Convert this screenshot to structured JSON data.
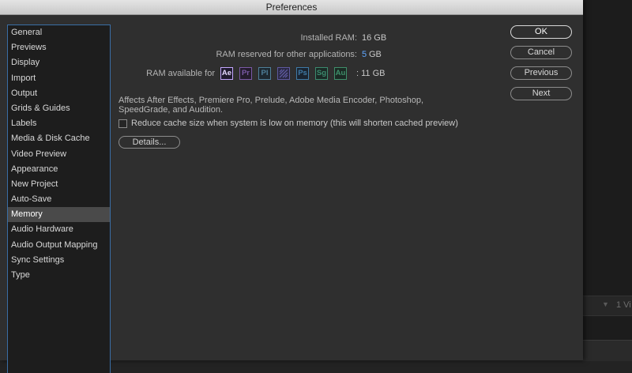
{
  "window": {
    "title": "Preferences"
  },
  "sidebar": {
    "items": [
      {
        "label": "General"
      },
      {
        "label": "Previews"
      },
      {
        "label": "Display"
      },
      {
        "label": "Import"
      },
      {
        "label": "Output"
      },
      {
        "label": "Grids & Guides"
      },
      {
        "label": "Labels"
      },
      {
        "label": "Media & Disk Cache"
      },
      {
        "label": "Video Preview"
      },
      {
        "label": "Appearance"
      },
      {
        "label": "New Project"
      },
      {
        "label": "Auto-Save"
      },
      {
        "label": "Memory",
        "selected": true
      },
      {
        "label": "Audio Hardware"
      },
      {
        "label": "Audio Output Mapping"
      },
      {
        "label": "Sync Settings"
      },
      {
        "label": "Type"
      }
    ]
  },
  "memory": {
    "installed_label": "Installed RAM:",
    "installed_value": "16 GB",
    "reserved_label": "RAM reserved for other applications:",
    "reserved_value": "5",
    "reserved_unit": "GB",
    "available_label": "RAM available for",
    "available_value": ": 11 GB",
    "apps": [
      {
        "abbr": "Ae",
        "color": "#c3a6ff",
        "bg": "#1f1a2e",
        "icon": "after-effects-icon"
      },
      {
        "abbr": "Pr",
        "color": "#7b5aa6",
        "bg": "#241c2c",
        "icon": "premiere-pro-icon"
      },
      {
        "abbr": "Pl",
        "color": "#4f7f9a",
        "bg": "#1d2830",
        "icon": "prelude-icon"
      },
      {
        "abbr": "",
        "color": "#5e5aa0",
        "bg": "#2a2842",
        "icon": "media-encoder-icon"
      },
      {
        "abbr": "Ps",
        "color": "#3f7aa6",
        "bg": "#1a2430",
        "icon": "photoshop-icon"
      },
      {
        "abbr": "Sg",
        "color": "#3c8a6e",
        "bg": "#1b2a26",
        "icon": "speedgrade-icon"
      },
      {
        "abbr": "Au",
        "color": "#3f8f6a",
        "bg": "#1b2a24",
        "icon": "audition-icon"
      }
    ],
    "affects_text": "Affects After Effects, Premiere Pro, Prelude, Adobe Media Encoder, Photoshop, SpeedGrade, and Audition.",
    "reduce_cache_label": "Reduce cache size when system is low on memory (this will shorten cached preview)",
    "reduce_cache_checked": false,
    "details_label": "Details..."
  },
  "buttons": {
    "ok": "OK",
    "cancel": "Cancel",
    "previous": "Previous",
    "next": "Next"
  },
  "background": {
    "panel_text": "1 Vi"
  }
}
